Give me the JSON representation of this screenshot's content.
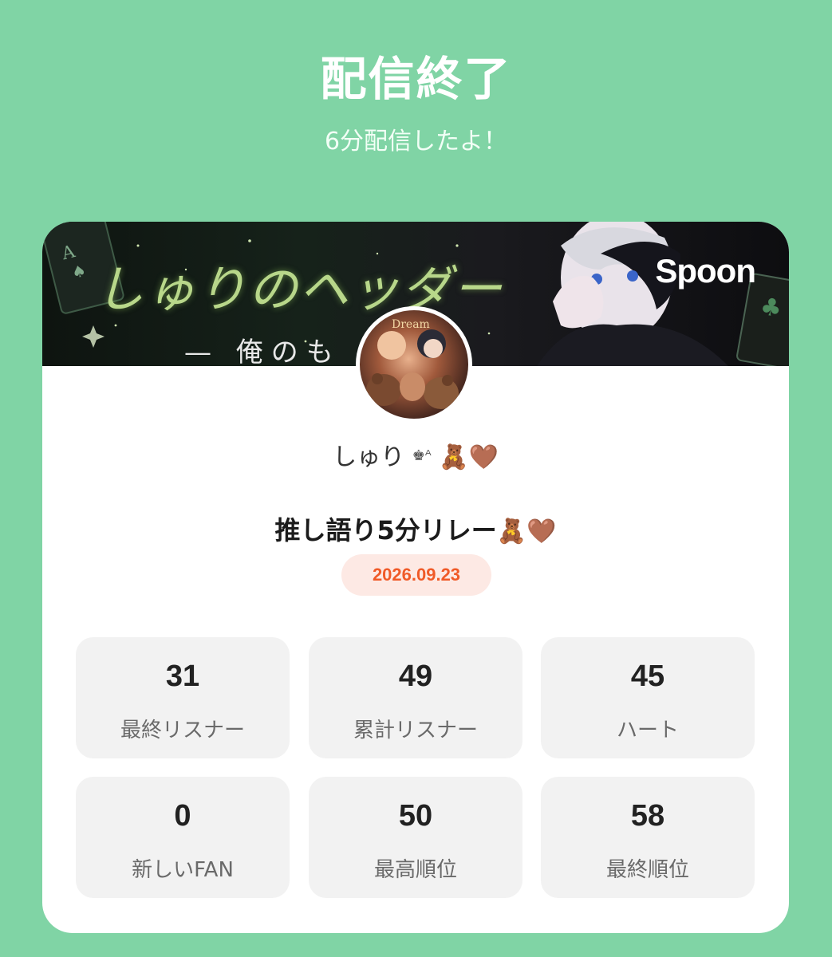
{
  "header": {
    "title": "配信終了",
    "subtitle": "6分配信したよ！"
  },
  "banner": {
    "title": "しゅりのヘッダー",
    "subtitle": "— 俺のも",
    "logo": "Spoon"
  },
  "profile": {
    "username": "しゅり",
    "badge": "♚ᴬ",
    "emoji": "🧸🤎"
  },
  "stream": {
    "title": "推し語り5分リレー",
    "emoji": "🧸🤎",
    "date": "2026.09.23"
  },
  "stats": [
    {
      "value": "31",
      "label": "最終リスナー"
    },
    {
      "value": "49",
      "label": "累計リスナー"
    },
    {
      "value": "45",
      "label": "ハート"
    },
    {
      "value": "0",
      "label": "新しいFAN"
    },
    {
      "value": "50",
      "label": "最高順位"
    },
    {
      "value": "58",
      "label": "最終順位"
    }
  ],
  "colors": {
    "background": "#80d4a5",
    "card": "#ffffff",
    "date_text": "#f05a28",
    "date_bg": "#fde9e4",
    "stat_bg": "#f2f2f2"
  }
}
